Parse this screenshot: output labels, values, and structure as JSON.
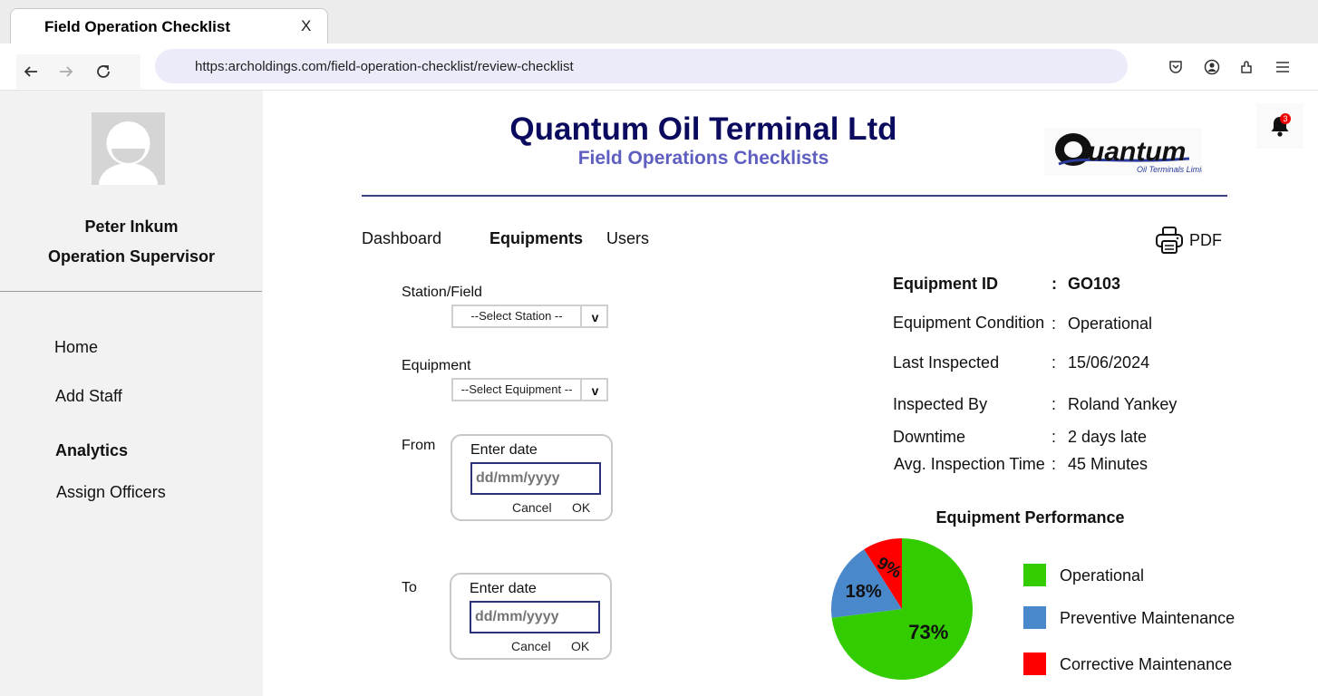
{
  "browser": {
    "tab_title": "Field Operation Checklist",
    "tab_close": "X",
    "url": "https:archoldings.com/field-operation-checklist/review-checklist"
  },
  "sidebar": {
    "user_name": "Peter Inkum",
    "user_role": "Operation Supervisor",
    "items": [
      {
        "label": "Home",
        "active": false
      },
      {
        "label": "Add Staff",
        "active": false
      },
      {
        "label": "Analytics",
        "active": true
      },
      {
        "label": "Assign Officers",
        "active": false
      }
    ]
  },
  "header": {
    "company": "Quantum Oil Terminal Ltd",
    "subtitle": "Field Operations Checklists",
    "logo_text": "uantum",
    "logo_subtext": "Oil Terminals Limited",
    "notification_count": "3"
  },
  "menu": {
    "dashboard": "Dashboard",
    "equipments": "Equipments",
    "users": "Users",
    "pdf": "PDF"
  },
  "filters": {
    "station_label": "Station/Field",
    "station_value": "--Select Station --",
    "equipment_label": "Equipment",
    "equipment_value": "--Select Equipment --",
    "arrow": "v",
    "from_label": "From",
    "to_label": "To",
    "date_label": "Enter date",
    "date_placeholder": "dd/mm/yyyy",
    "cancel": "Cancel",
    "ok": "OK"
  },
  "info": {
    "separator": ":",
    "rows": [
      {
        "label": "Equipment ID",
        "value": "GO103"
      },
      {
        "label": "Equipment Condition",
        "value": "Operational"
      },
      {
        "label": "Last Inspected",
        "value": "15/06/2024"
      },
      {
        "label": "Inspected By",
        "value": "Roland Yankey"
      },
      {
        "label": "Downtime",
        "value": "2 days late"
      },
      {
        "label": "Avg. Inspection Time",
        "value": "45 Minutes"
      }
    ]
  },
  "colors": {
    "operational": "#33cc00",
    "preventive": "#4a88cc",
    "corrective": "#ff0000"
  },
  "chart_data": {
    "type": "pie",
    "title": "Equipment Performance",
    "categories": [
      "Operational",
      "Preventive Maintenance",
      "Corrective Maintenance"
    ],
    "values": [
      73,
      18,
      9
    ],
    "labels": [
      "73%",
      "18%",
      "9%"
    ],
    "legend": "right"
  }
}
